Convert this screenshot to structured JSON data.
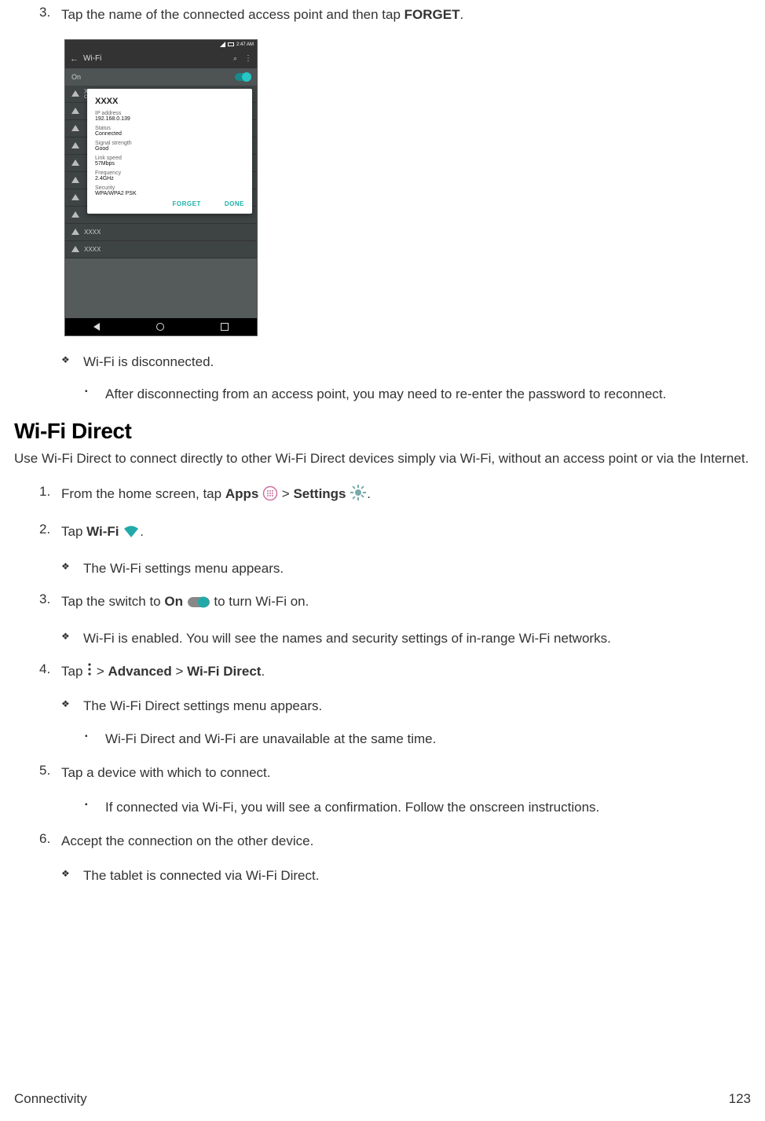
{
  "step3": {
    "num": "3.",
    "pre": "Tap the name of the connected access point and then tap ",
    "bold": "FORGET",
    "post": "."
  },
  "phone": {
    "time": "2:47 AM",
    "title": "Wi-Fi",
    "on": "On",
    "net_top": {
      "name": "XXXX",
      "sub": "Connected"
    },
    "dialog": {
      "title": "XXXX",
      "rows": [
        {
          "label": "IP address",
          "value": "192.168.0.139"
        },
        {
          "label": "Status",
          "value": "Connected"
        },
        {
          "label": "Signal strength",
          "value": "Good"
        },
        {
          "label": "Link speed",
          "value": "57Mbps"
        },
        {
          "label": "Frequency",
          "value": "2.4GHz"
        },
        {
          "label": "Security",
          "value": "WPA/WPA2 PSK"
        }
      ],
      "forget": "FORGET",
      "done": "DONE"
    },
    "bottom_rows": [
      "XXXX",
      "XXXX"
    ]
  },
  "step3_sub1": "Wi-Fi is disconnected.",
  "step3_sub2": "After disconnecting from an access point, you may need to re-enter the password to reconnect.",
  "section_title": "Wi-Fi Direct",
  "intro": "Use Wi-Fi Direct to connect directly to other Wi-Fi Direct devices simply via Wi-Fi, without an access point or via the Internet.",
  "steps": {
    "1": {
      "num": "1.",
      "pre": "From the home screen, tap ",
      "b1": "Apps",
      "mid": " > ",
      "b2": "Settings",
      "post": "."
    },
    "2": {
      "num": "2.",
      "pre": "Tap ",
      "b1": "Wi-Fi",
      "post": "."
    },
    "2s": "The Wi-Fi settings menu appears.",
    "3": {
      "num": "3.",
      "pre": "Tap the switch to ",
      "b1": "On",
      "post": " to turn Wi-Fi on."
    },
    "3s": "Wi-Fi is enabled. You will see the names and security settings of in-range Wi-Fi networks.",
    "4": {
      "num": "4.",
      "pre": "Tap ",
      "mid": " > ",
      "b1": "Advanced",
      "mid2": " > ",
      "b2": "Wi-Fi Direct",
      "post": "."
    },
    "4s": "The Wi-Fi Direct settings menu appears.",
    "4s2": "Wi-Fi Direct and Wi-Fi are unavailable at the same time.",
    "5": {
      "num": "5.",
      "text": "Tap a device with which to connect."
    },
    "5s2": "If connected via Wi-Fi, you will see a confirmation. Follow the onscreen instructions.",
    "6": {
      "num": "6.",
      "text": "Accept the connection on the other device."
    },
    "6s": "The tablet is connected via Wi-Fi Direct."
  },
  "footer": {
    "left": "Connectivity",
    "right": "123"
  }
}
